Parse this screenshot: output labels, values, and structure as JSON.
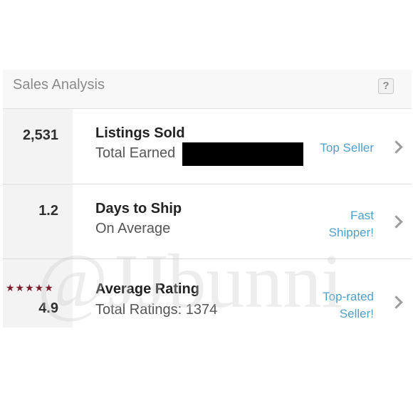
{
  "header": {
    "title": "Sales Analysis",
    "help_label": "?"
  },
  "rows": [
    {
      "value": "2,531",
      "title": "Listings Sold",
      "subtitle": "Total Earned",
      "badge_line1": "Top Seller",
      "badge_line2": ""
    },
    {
      "value": "1.2",
      "title": "Days to Ship",
      "subtitle": "On Average",
      "badge_line1": "Fast",
      "badge_line2": "Shipper!"
    },
    {
      "value": "4.9",
      "stars": "★★★★★",
      "title": "Average Rating",
      "subtitle": "Total Ratings: 1374",
      "badge_line1": "Top-rated",
      "badge_line2": "Seller!"
    }
  ],
  "watermark": "@JJbunni",
  "colors": {
    "accent_link": "#4fa0c8",
    "star": "#7a1f2b",
    "redaction": "#000000"
  }
}
